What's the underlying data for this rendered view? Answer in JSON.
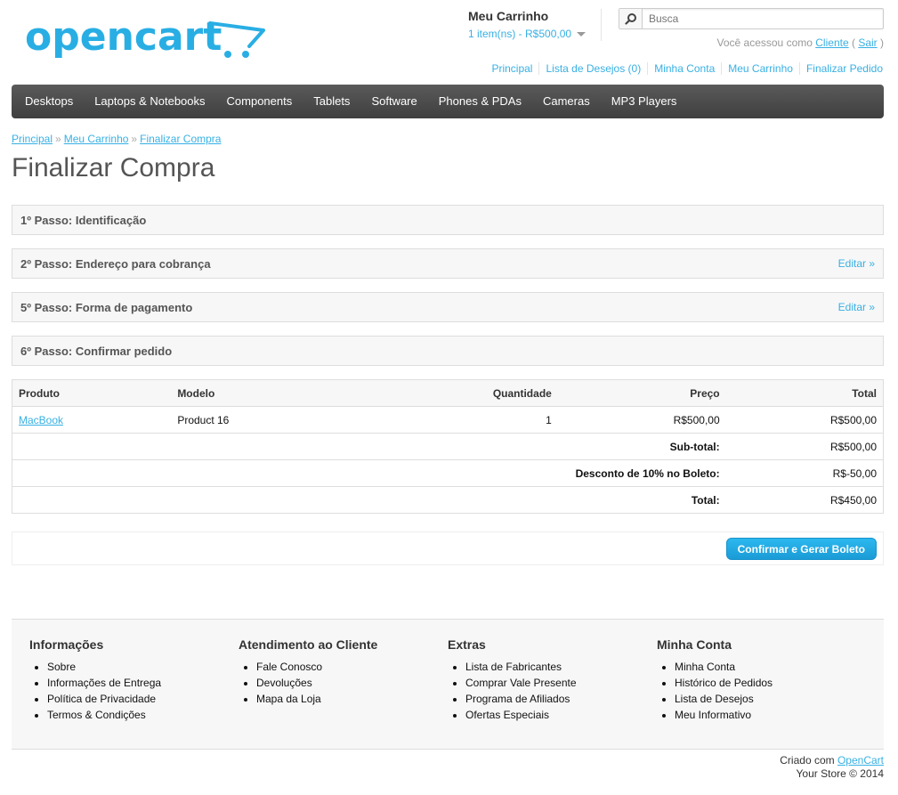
{
  "logo_text": "opencart",
  "cart": {
    "title": "Meu Carrinho",
    "summary": "1 item(ns) - R$500,00"
  },
  "search": {
    "placeholder": "Busca"
  },
  "welcome": {
    "prefix": "Você acessou como",
    "user": "Cliente",
    "open": "(",
    "logout": "Sair",
    "close": ")"
  },
  "top_links": [
    "Principal",
    "Lista de Desejos (0)",
    "Minha Conta",
    "Meu Carrinho",
    "Finalizar Pedido"
  ],
  "menu": [
    "Desktops",
    "Laptops & Notebooks",
    "Components",
    "Tablets",
    "Software",
    "Phones & PDAs",
    "Cameras",
    "MP3 Players"
  ],
  "breadcrumb": {
    "items": [
      "Principal",
      "Meu Carrinho",
      "Finalizar Compra"
    ],
    "separator": "»"
  },
  "page_title": "Finalizar Compra",
  "steps": [
    {
      "title": "1º Passo: Identificação",
      "edit": ""
    },
    {
      "title": "2º Passo: Endereço para cobrança",
      "edit": "Editar »"
    },
    {
      "title": "5º Passo: Forma de pagamento",
      "edit": "Editar »"
    },
    {
      "title": "6º Passo: Confirmar pedido",
      "edit": ""
    }
  ],
  "order_table": {
    "headers": [
      "Produto",
      "Modelo",
      "Quantidade",
      "Preço",
      "Total"
    ],
    "product": {
      "name": "MacBook",
      "model": "Product 16",
      "quantity": "1",
      "price": "R$500,00",
      "total": "R$500,00"
    },
    "totals": [
      {
        "label": "Sub-total:",
        "value": "R$500,00"
      },
      {
        "label": "Desconto de 10% no Boleto:",
        "value": "R$-50,00"
      },
      {
        "label": "Total:",
        "value": "R$450,00"
      }
    ]
  },
  "confirm_button": "Confirmar e Gerar Boleto",
  "footer": {
    "columns": [
      {
        "title": "Informações",
        "items": [
          "Sobre",
          "Informações de Entrega",
          "Política de Privacidade",
          "Termos & Condições"
        ]
      },
      {
        "title": "Atendimento ao Cliente",
        "items": [
          "Fale Conosco",
          "Devoluções",
          "Mapa da Loja"
        ]
      },
      {
        "title": "Extras",
        "items": [
          "Lista de Fabricantes",
          "Comprar Vale Presente",
          "Programa de Afiliados",
          "Ofertas Especiais"
        ]
      },
      {
        "title": "Minha Conta",
        "items": [
          "Minha Conta",
          "Histórico de Pedidos",
          "Lista de Desejos",
          "Meu Informativo"
        ]
      }
    ],
    "powered_prefix": "Criado com",
    "powered_link": "OpenCart",
    "copyright": "Your Store © 2014"
  },
  "colors": {
    "accent": "#38b0e3",
    "menu_bg": "#4a4a4a",
    "button": "#1fa7e2"
  }
}
